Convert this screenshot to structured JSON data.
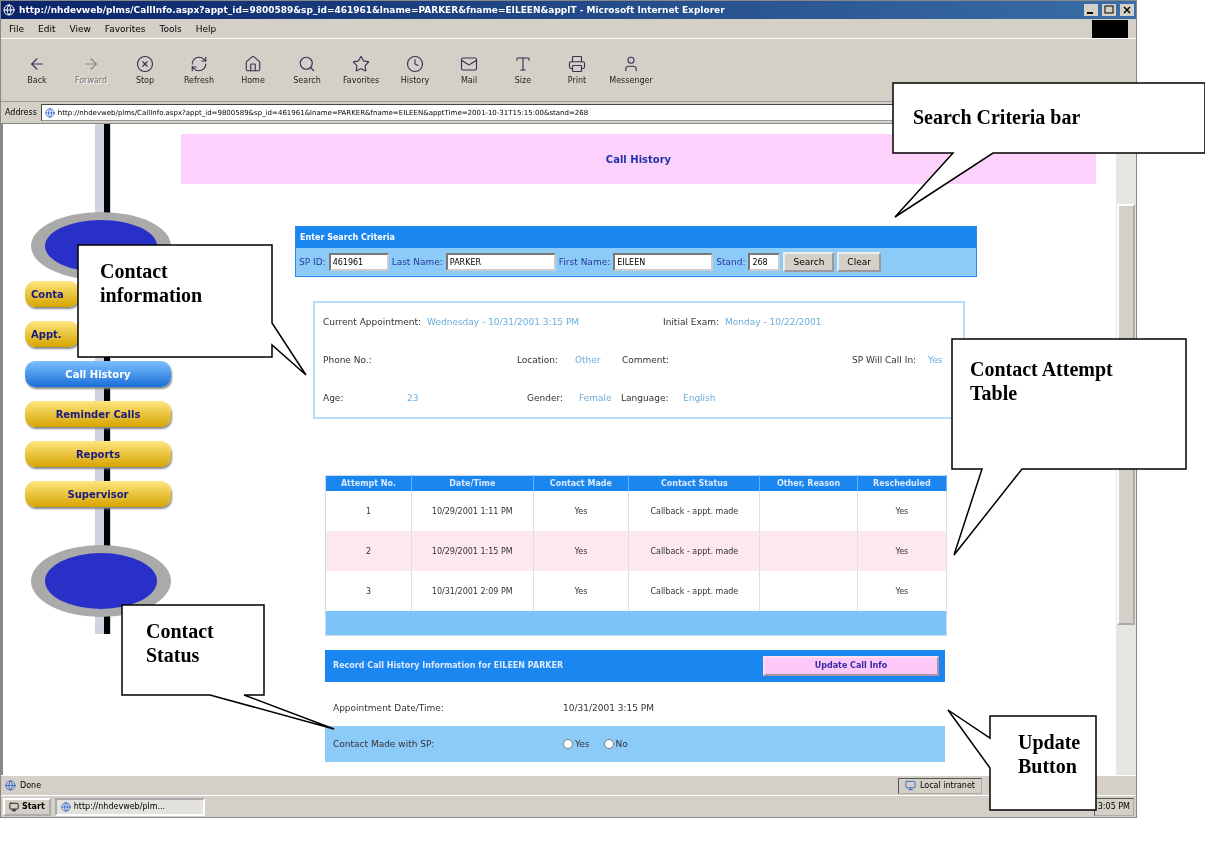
{
  "window": {
    "title": "http://nhdevweb/plms/CallInfo.aspx?appt_id=9800589&sp_id=461961&lname=PARKER&fname=EILEEN&applT - Microsoft Internet Explorer"
  },
  "menu": [
    "File",
    "Edit",
    "View",
    "Favorites",
    "Tools",
    "Help"
  ],
  "toolbar": [
    {
      "kind": "back",
      "label": "Back",
      "disabled": false
    },
    {
      "kind": "forward",
      "label": "Forward",
      "disabled": true
    },
    {
      "kind": "stop",
      "label": "Stop",
      "disabled": false
    },
    {
      "kind": "refresh",
      "label": "Refresh",
      "disabled": false
    },
    {
      "kind": "home",
      "label": "Home",
      "disabled": false
    },
    {
      "kind": "search",
      "label": "Search",
      "disabled": false
    },
    {
      "kind": "favorites",
      "label": "Favorites",
      "disabled": false
    },
    {
      "kind": "history",
      "label": "History",
      "disabled": false
    },
    {
      "kind": "mail",
      "label": "Mail",
      "disabled": false
    },
    {
      "kind": "size",
      "label": "Size",
      "disabled": false
    },
    {
      "kind": "print",
      "label": "Print",
      "disabled": false
    },
    {
      "kind": "messenger",
      "label": "Messenger",
      "disabled": false
    }
  ],
  "address": {
    "label": "Address",
    "value": "http://nhdevweb/plms/CallInfo.aspx?appt_id=9800589&sp_id=461961&lname=PARKER&fname=EILEEN&apptTime=2001-10-31T15:15:00&stand=268"
  },
  "nav": [
    {
      "label": "Conta",
      "selected": false
    },
    {
      "label": "Appt.",
      "selected": false
    },
    {
      "label": "Call History",
      "selected": true
    },
    {
      "label": "Reminder Calls",
      "selected": false
    },
    {
      "label": "Reports",
      "selected": false
    },
    {
      "label": "Supervisor",
      "selected": false
    }
  ],
  "page_title": "Call History",
  "search": {
    "title": "Enter Search Criteria",
    "fields": [
      {
        "label": "SP ID:",
        "value": "461961"
      },
      {
        "label": "Last Name:",
        "value": "PARKER"
      },
      {
        "label": "First Name:",
        "value": "EILEEN"
      },
      {
        "label": "Stand:",
        "value": "268"
      }
    ],
    "buttons": [
      "Search",
      "Clear"
    ]
  },
  "contact": {
    "current_appointment": {
      "label": "Current Appointment:",
      "value": "Wednesday - 10/31/2001 3:15 PM"
    },
    "initial_exam": {
      "label": "Initial Exam:",
      "value": "Monday - 10/22/2001"
    },
    "phone": {
      "label": "Phone No.:"
    },
    "location": {
      "label": "Location:",
      "value": "Other"
    },
    "comment": {
      "label": "Comment:"
    },
    "will_call_in": {
      "label": "SP Will Call In:",
      "value": "Yes"
    },
    "age": {
      "label": "Age:",
      "value": "23"
    },
    "gender": {
      "label": "Gender:",
      "value": "Female"
    },
    "language": {
      "label": "Language:",
      "value": "English"
    }
  },
  "attempts": {
    "columns": [
      "Attempt No.",
      "Date/Time",
      "Contact Made",
      "Contact Status",
      "Other, Reason",
      "Rescheduled"
    ],
    "rows": [
      [
        "1",
        "10/29/2001 1:11 PM",
        "Yes",
        "Callback - appt. made",
        null,
        "Yes"
      ],
      [
        "2",
        "10/29/2001 1:15 PM",
        "Yes",
        "Callback - appt. made",
        null,
        "Yes"
      ],
      [
        "3",
        "10/31/2001 2:09 PM",
        "Yes",
        "Callback - appt. made",
        null,
        "Yes"
      ]
    ]
  },
  "record": {
    "title": "Record Call History Information for EILEEN PARKER",
    "button": "Update Call Info",
    "appointment_label": "Appointment Date/Time:",
    "appointment_value": "10/31/2001 3:15 PM",
    "contact_made_label": "Contact Made with SP:",
    "options": [
      {
        "label": "Yes",
        "checked": false
      },
      {
        "label": "No",
        "checked": false
      }
    ]
  },
  "status_bar": {
    "text": "Done",
    "zone": "Local intranet"
  },
  "taskbar": {
    "start": "Start",
    "task": "http://nhdevweb/plm...",
    "time": "3:05 PM"
  },
  "callouts": [
    {
      "text": "Search Criteria bar"
    },
    {
      "text": "Contact information"
    },
    {
      "text": "Contact Attempt Table"
    },
    {
      "text": "Contact Status"
    },
    {
      "text": "Update Button"
    }
  ]
}
